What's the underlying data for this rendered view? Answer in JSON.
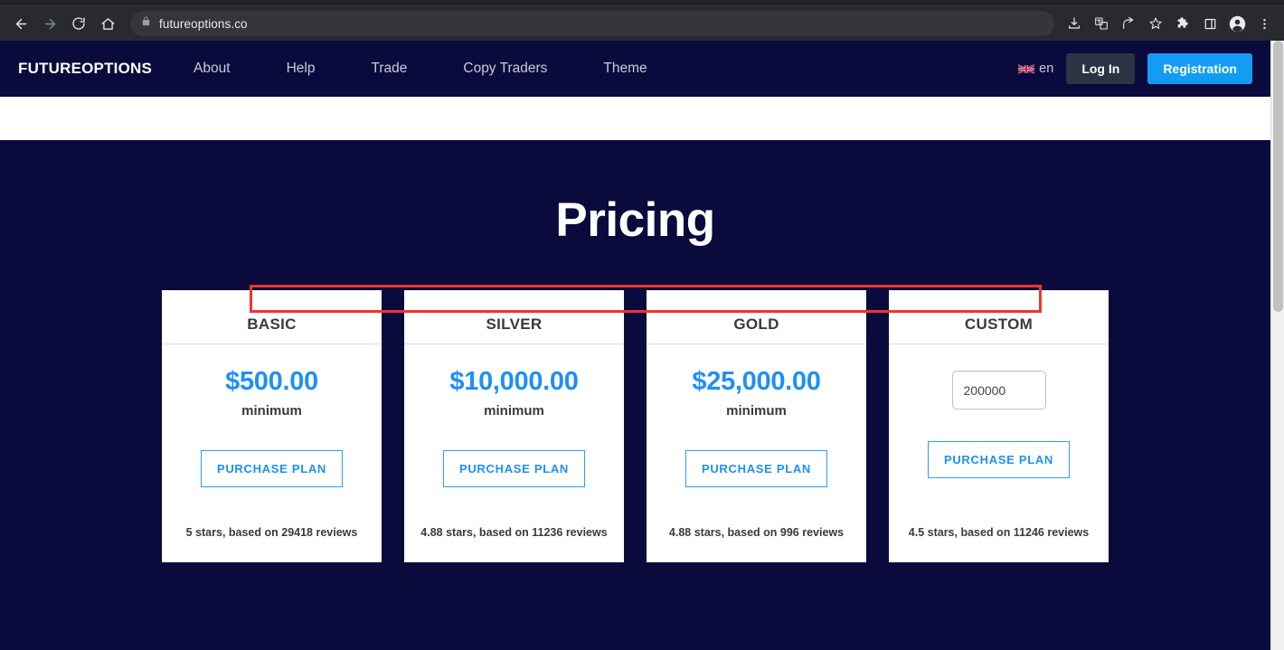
{
  "browser": {
    "url": "futureoptions.co",
    "back_icon": "back-arrow-icon",
    "forward_icon": "forward-arrow-icon",
    "reload_icon": "reload-icon",
    "home_icon": "home-icon",
    "lock_icon": "lock-icon",
    "right_icons": [
      "download-icon",
      "translate-icon",
      "share-icon",
      "bookmark-star-icon",
      "extensions-puzzle-icon",
      "side-panel-icon",
      "profile-avatar-icon",
      "three-dot-menu-icon"
    ]
  },
  "header": {
    "brand": "FUTUREOPTIONS",
    "nav": [
      {
        "label": "About"
      },
      {
        "label": "Help"
      },
      {
        "label": "Trade"
      },
      {
        "label": "Copy Traders"
      },
      {
        "label": "Theme"
      }
    ],
    "language": "en",
    "language_flag": "uk-flag-icon",
    "login_label": "Log In",
    "registration_label": "Registration"
  },
  "pricing": {
    "title": "Pricing",
    "cards": [
      {
        "name": "BASIC",
        "price": "$500.00",
        "sub": "minimum",
        "button": "PURCHASE PLAN",
        "reviews": "5 stars, based on 29418 reviews"
      },
      {
        "name": "SILVER",
        "price": "$10,000.00",
        "sub": "minimum",
        "button": "PURCHASE PLAN",
        "reviews": "4.88 stars, based on 11236 reviews"
      },
      {
        "name": "GOLD",
        "price": "$25,000.00",
        "sub": "minimum",
        "button": "PURCHASE PLAN",
        "reviews": "4.88 stars, based on 996 reviews"
      },
      {
        "name": "CUSTOM",
        "input_value": "200000",
        "button": "PURCHASE PLAN",
        "reviews": "4.5 stars, based on 11246 reviews"
      }
    ]
  },
  "colors": {
    "page_background": "#0a0a3c",
    "accent_blue": "#129cf3",
    "price_blue": "#1e90f5",
    "annotation_red": "#f0342e",
    "card_background": "#ffffff"
  }
}
